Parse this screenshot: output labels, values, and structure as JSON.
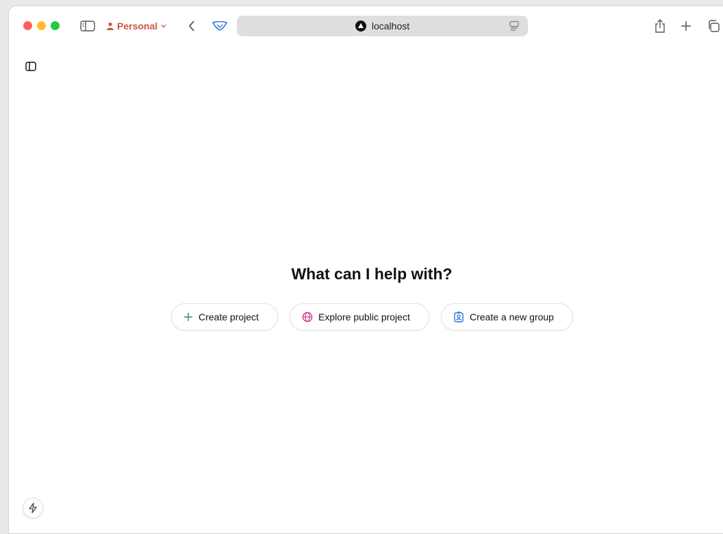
{
  "browser": {
    "profile_label": "Personal",
    "address": "localhost"
  },
  "main": {
    "headline": "What can I help with?",
    "actions": [
      {
        "label": "Create project",
        "icon": "plus-icon",
        "color": "#2f8f78"
      },
      {
        "label": "Explore public project",
        "icon": "globe-icon",
        "color": "#d63384"
      },
      {
        "label": "Create a new group",
        "icon": "contact-card-icon",
        "color": "#2f6fdb"
      }
    ]
  },
  "colors": {
    "profile": "#c8584a",
    "shield": "#2f6fdb"
  }
}
